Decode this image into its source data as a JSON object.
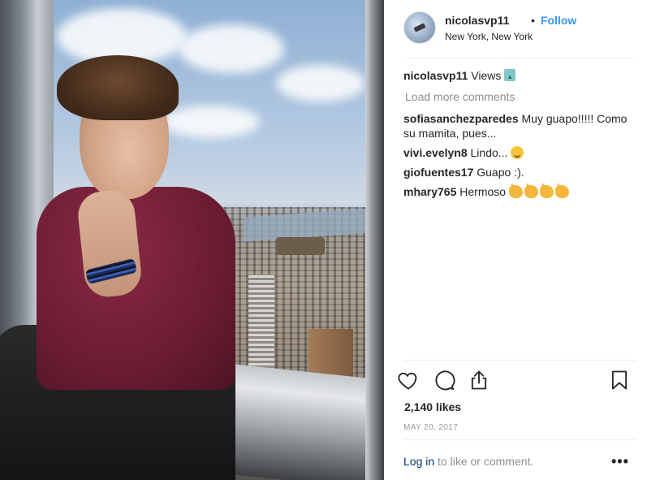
{
  "post": {
    "username": "nicolasvp11",
    "separator": "•",
    "follow_label": "Follow",
    "location": "New York, New York",
    "caption": {
      "username": "nicolasvp11",
      "text": "Views"
    },
    "load_more_label": "Load more comments",
    "comments": [
      {
        "username": "sofiasanchezparedes",
        "text": "Muy guapo!!!!! Como su mamita, pues..."
      },
      {
        "username": "vivi.evelyn8",
        "text": "Lindo..."
      },
      {
        "username": "giofuentes17",
        "text": "Guapo :)."
      },
      {
        "username": "mhary765",
        "text": "Hermoso"
      }
    ],
    "likes": "2,140 likes",
    "date": "MAY 20, 2017",
    "login_link": "Log in",
    "login_suffix": "to like or comment.",
    "more_label": "•••"
  },
  "icons": {
    "like": "heart-icon",
    "comment": "comment-icon",
    "share": "share-icon",
    "save": "bookmark-icon"
  },
  "colors": {
    "accent": "#3897f0",
    "login_link": "#003569",
    "muted": "#8e8e8e"
  }
}
